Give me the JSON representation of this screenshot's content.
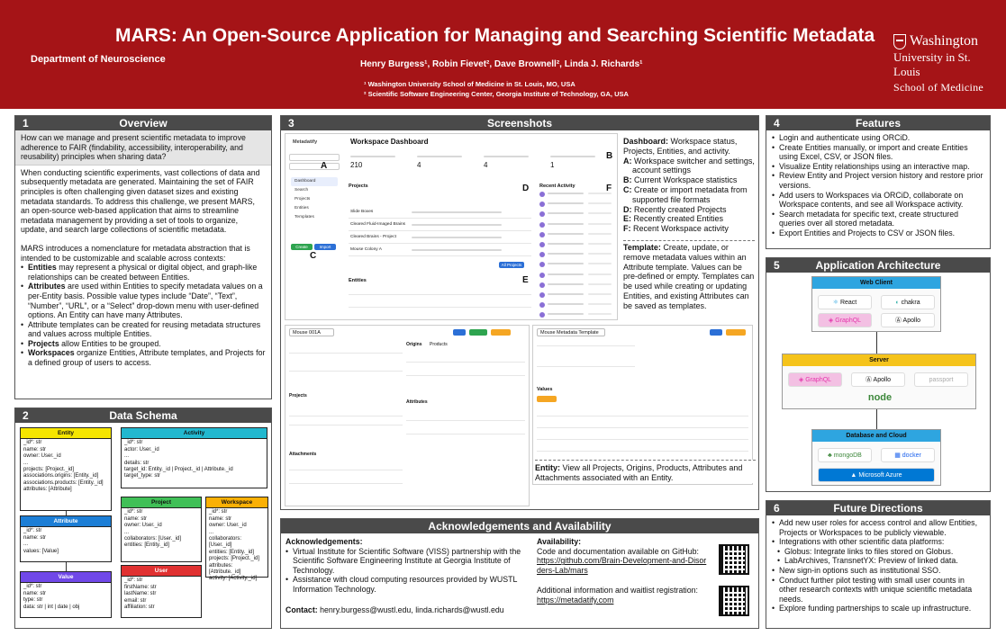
{
  "header": {
    "title": "MARS: An Open-Source Application for Managing and Searching Scientific Metadata",
    "department": "Department of Neuroscience",
    "authors": "Henry Burgess¹, Robin Fievet², Dave Brownell², Linda J. Richards¹",
    "affiliation1": "¹ Washington University School of Medicine in St. Louis, MO, USA",
    "affiliation2": "² Scientific Software Engineering Center, Georgia Institute of Technology, GA, USA",
    "logo_line1": "Washington",
    "logo_line2": "University in St. Louis",
    "logo_line3": "School of Medicine"
  },
  "overview": {
    "num": "1",
    "title": "Overview",
    "question": "How can we manage and present scientific metadata to improve adherence to FAIR (findability, accessibility, interoperability, and reusability) principles when sharing data?",
    "para1": "When conducting scientific experiments, vast collections of data and subsequently metadata are generated. Maintaining the set of FAIR principles is often challenging given dataset sizes and existing metadata standards. To address this challenge, we present MARS, an open-source web-based application that aims to streamline metadata management by providing a set of tools to organize, update, and search large collections of scientific metadata.",
    "para2": "MARS introduces a nomenclature for metadata abstraction that is intended to be customizable and scalable across contexts:",
    "bullets": [
      {
        "term": "Entities",
        "text": " may represent a physical or digital object, and graph-like relationships can be created between Entities."
      },
      {
        "term": "Attributes",
        "text": " are used within Entities to specify metadata values on a per-Entity basis. Possible value types include “Date”, “Text”, “Number”, “URL”, or a “Select” drop-down menu with user-defined options. An Entity can have many Attributes."
      },
      {
        "term": "",
        "text": "Attribute templates can be created for reusing metadata structures and values across multiple Entities."
      },
      {
        "term": "Projects",
        "text": " allow Entities to be grouped."
      },
      {
        "term": "Workspaces",
        "text": " organize Entities, Attribute templates, and Projects for a defined group of users to access."
      }
    ]
  },
  "schema": {
    "num": "2",
    "title": "Data Schema",
    "entity": {
      "name": "Entity",
      "fields": [
        "_id*: str",
        "name: str",
        "owner: User._id",
        "...",
        "projects: [Project._id]",
        "associations.origins: [Entity._id]",
        "associations.products: [Entity._id]",
        "attributes: [Attribute]"
      ]
    },
    "activity": {
      "name": "Activity",
      "fields": [
        "_id*: str",
        "actor: User._id",
        "...",
        "details: str",
        "target_id: Entity._id | Project._id | Attribute._id",
        "target_type: str"
      ]
    },
    "attribute": {
      "name": "Attribute",
      "fields": [
        "_id*: str",
        "name: str",
        "...",
        "values: [Value]"
      ]
    },
    "project": {
      "name": "Project",
      "fields": [
        "_id*: str",
        "name: str",
        "owner: User._id",
        "...",
        "collaborators: [User._id]",
        "entities: [Entity._id]"
      ]
    },
    "workspace": {
      "name": "Workspace",
      "fields": [
        "_id*: str",
        "name: str",
        "owner: User._id",
        "...",
        "collaborators: [User._id]",
        "entities: [Entity._id]",
        "projects: [Project._id]",
        "attributes: [Attribute._id]",
        "activity: [Activity._id]"
      ]
    },
    "value": {
      "name": "Value",
      "fields": [
        "_id*: str",
        "name: str",
        "type: str",
        "data: str | int | date | obj"
      ]
    },
    "user": {
      "name": "User",
      "fields": [
        "_id*: str",
        "firstName: str",
        "lastName: str",
        "email: str",
        "affiliation: str"
      ]
    },
    "colors": {
      "entity": "#f5e500",
      "activity": "#22b8cf",
      "attribute": "#1c7ed6",
      "project": "#40c057",
      "workspace": "#fab005",
      "value": "#7048e8",
      "user": "#e03131"
    }
  },
  "screenshots": {
    "num": "3",
    "title": "Screenshots",
    "dashboard_mock": {
      "app_name": "Metadatify",
      "heading": "Workspace Dashboard",
      "stats": [
        "210",
        "4",
        "4",
        "1"
      ],
      "nav": [
        "Dashboard",
        "Search",
        "Projects",
        "Entities",
        "Templates"
      ],
      "create": "Create",
      "import": "Import",
      "projects_label": "Projects",
      "entities_label": "Entities",
      "activity_label": "Recent Activity",
      "project_rows": [
        "Slide Boxes",
        "Cleared Fluid-Imaged Brains",
        "Cleared Brains - Project",
        "Mouse Colony A"
      ],
      "all_projects": "All Projects"
    },
    "entity_mock": {
      "title": "Mouse 001A",
      "origins": "Origins",
      "products": "Products",
      "projects": "Projects",
      "attributes": "Attributes",
      "attachments": "Attachments"
    },
    "template_mock": {
      "title": "Mouse Metadata Template",
      "values": "Values"
    },
    "tags": {
      "A": "A",
      "B": "B",
      "C": "C",
      "D": "D",
      "E": "E",
      "F": "F"
    },
    "dashboard_caption_head": "Dashboard:",
    "dashboard_caption": " Workspace status, Projects, Entities, and activity.",
    "dashboard_items": [
      {
        "k": "A:",
        "v": " Workspace switcher and settings, account settings"
      },
      {
        "k": "B:",
        "v": " Current Workspace statistics"
      },
      {
        "k": "C:",
        "v": " Create or import metadata from supported file formats"
      },
      {
        "k": "D:",
        "v": " Recently created Projects"
      },
      {
        "k": "E:",
        "v": " Recently created Entities"
      },
      {
        "k": "F:",
        "v": " Recent Workspace activity"
      }
    ],
    "template_caption_head": "Template:",
    "template_caption": " Create, update, or remove metadata values within an Attribute template. Values can be pre-defined or empty. Templates can be used while creating or updating Entities, and existing Attributes can be saved as templates.",
    "entity_caption_head": "Entity:",
    "entity_caption": " View all Projects, Origins, Products, Attributes and Attachments associated with an Entity."
  },
  "features": {
    "num": "4",
    "title": "Features",
    "items": [
      "Login and authenticate using ORCiD.",
      "Create Entities manually, or import and create Entities using Excel, CSV, or JSON files.",
      "Visualize Entity relationships using an interactive map.",
      "Review Entity and Project version history and restore prior versions.",
      "Add users to Workspaces via ORCiD, collaborate on Workspace contents, and see all Workspace activity.",
      "Search metadata for specific text, create structured queries over all stored metadata.",
      "Export Entities and Projects to CSV or JSON files."
    ]
  },
  "architecture": {
    "num": "5",
    "title": "Application Architecture",
    "web_client": "Web Client",
    "client_chips": [
      "React",
      "chakra",
      "GraphQL",
      "Apollo"
    ],
    "server": "Server",
    "server_chips": [
      "GraphQL",
      "Apollo",
      "passport",
      "node"
    ],
    "database": "Database and Cloud",
    "db_chips": [
      "mongoDB",
      "docker",
      "Microsoft Azure"
    ],
    "colors": {
      "client": "#2ea5e0",
      "server": "#f5c31b",
      "db": "#2ea5e0",
      "node": "#3c873a",
      "graphql": "#e535ab",
      "azure": "#0078d4"
    }
  },
  "future": {
    "num": "6",
    "title": "Future Directions",
    "items": [
      {
        "text": "Add new user roles for access control and allow Entities, Projects or Workspaces to be publicly viewable.",
        "sub": false
      },
      {
        "text": "Integrations with other scientific data platforms:",
        "sub": false
      },
      {
        "text": "Globus: Integrate links to files stored on Globus.",
        "sub": true
      },
      {
        "text": "LabArchives, TransnetYX: Preview of linked data.",
        "sub": true
      },
      {
        "text": "New sign-in options such as institutional SSO.",
        "sub": false
      },
      {
        "text": "Conduct further pilot testing with small user counts in other research contexts with unique scientific metadata needs.",
        "sub": false
      },
      {
        "text": "Explore funding partnerships to scale up infrastructure.",
        "sub": false
      }
    ]
  },
  "ack": {
    "title": "Acknowledgements and Availability",
    "ack_head": "Acknowledgements:",
    "ack_items": [
      "Virtual Institute for Scientific Software (VISS) partnership with the Scientific Software Engineering Institute at Georgia Institute of Technology.",
      "Assistance with cloud computing resources provided by WUSTL Information Technology."
    ],
    "contact_head": "Contact:",
    "contact": " henry.burgess@wustl.edu, linda.richards@wustl.edu",
    "avail_head": "Availability:",
    "avail_text": "Code and documentation available on GitHub:",
    "github": "https://github.com/Brain-Development-and-Disorders-Lab/mars",
    "waitlist_text": "Additional information and waitlist registration:",
    "waitlist": "https://metadatify.com"
  }
}
